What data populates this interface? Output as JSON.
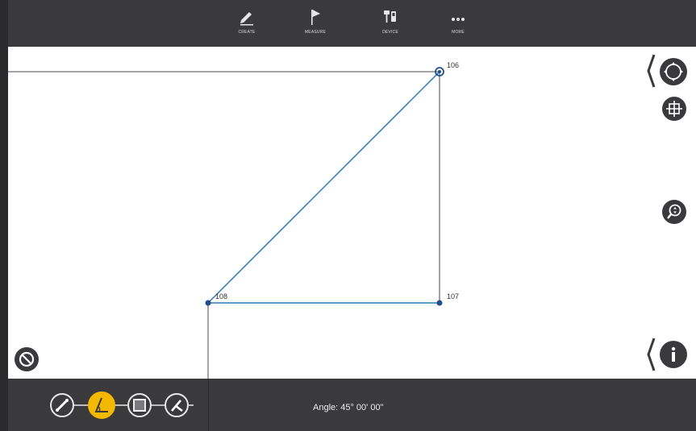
{
  "toolbar": {
    "items": [
      {
        "label": "CREATE",
        "icon": "pencil-icon"
      },
      {
        "label": "MEASURE",
        "icon": "flag-icon"
      },
      {
        "label": "DEVICE",
        "icon": "device-icon"
      },
      {
        "label": "MORE",
        "icon": "more-icon"
      }
    ]
  },
  "canvas": {
    "points": [
      {
        "label": "106"
      },
      {
        "label": "107"
      },
      {
        "label": "108"
      }
    ],
    "colors": {
      "measure_line": "#2f79b8",
      "point": "#1f4f8a",
      "grid_line": "#4a4a4a"
    }
  },
  "side_controls": [
    "pan-icon",
    "crosshair-icon",
    "zoom-icon",
    "info-icon"
  ],
  "left_controls": [
    "cancel-icon"
  ],
  "bottom": {
    "tools": [
      {
        "name": "distance-tool",
        "icon": "ruler-icon"
      },
      {
        "name": "angle-tool",
        "icon": "angle-icon",
        "active": true
      },
      {
        "name": "area-tool",
        "icon": "square-icon"
      },
      {
        "name": "arc-tool",
        "icon": "compass-icon"
      }
    ],
    "readout": "Angle: 45° 00' 00\"",
    "accent": "#f5b800"
  }
}
